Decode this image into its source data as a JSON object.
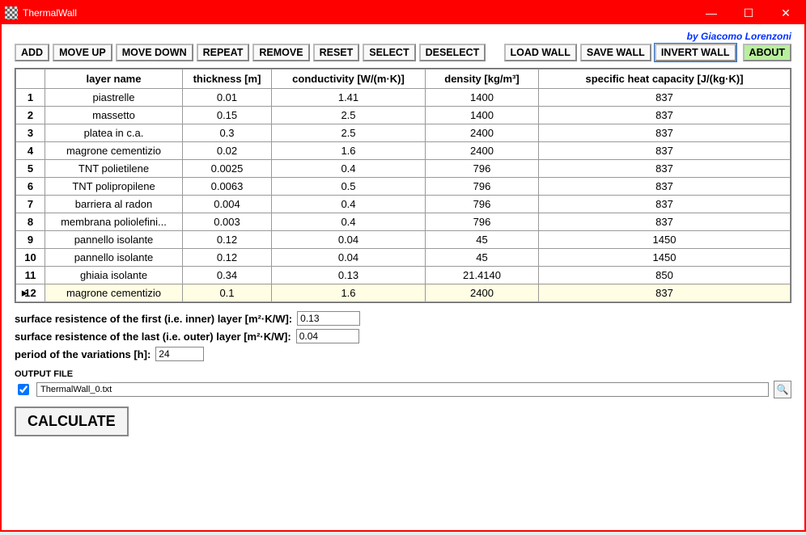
{
  "window": {
    "title": "ThermalWall"
  },
  "byline": "by Giacomo Lorenzoni",
  "win_controls": {
    "min": "—",
    "max": "☐",
    "close": "✕"
  },
  "toolbar": {
    "add": "ADD",
    "move_up": "MOVE UP",
    "move_down": "MOVE DOWN",
    "repeat": "REPEAT",
    "remove": "REMOVE",
    "reset": "RESET",
    "select": "SELECT",
    "deselect": "DESELECT",
    "load": "LOAD WALL",
    "save": "SAVE WALL",
    "invert": "INVERT WALL",
    "about": "ABOUT"
  },
  "columns": {
    "layer": "layer name",
    "thickness": "thickness  [m]",
    "conductivity": "conductivity  [W/(m·K)]",
    "density": "density  [kg/m³]",
    "shc": "specific heat capacity  [J/(kg·K)]"
  },
  "rows": [
    {
      "n": "1",
      "layer": "piastrelle",
      "thickness": "0.01",
      "conductivity": "1.41",
      "density": "1400",
      "shc": "837",
      "sel": false
    },
    {
      "n": "2",
      "layer": "massetto",
      "thickness": "0.15",
      "conductivity": "2.5",
      "density": "1400",
      "shc": "837",
      "sel": false
    },
    {
      "n": "3",
      "layer": "platea in c.a.",
      "thickness": "0.3",
      "conductivity": "2.5",
      "density": "2400",
      "shc": "837",
      "sel": false
    },
    {
      "n": "4",
      "layer": "magrone cementizio",
      "thickness": "0.02",
      "conductivity": "1.6",
      "density": "2400",
      "shc": "837",
      "sel": false
    },
    {
      "n": "5",
      "layer": "TNT polietilene",
      "thickness": "0.0025",
      "conductivity": "0.4",
      "density": "796",
      "shc": "837",
      "sel": false
    },
    {
      "n": "6",
      "layer": "TNT polipropilene",
      "thickness": "0.0063",
      "conductivity": "0.5",
      "density": "796",
      "shc": "837",
      "sel": false
    },
    {
      "n": "7",
      "layer": "barriera al radon",
      "thickness": "0.004",
      "conductivity": "0.4",
      "density": "796",
      "shc": "837",
      "sel": false
    },
    {
      "n": "8",
      "layer": "membrana poliolefini...",
      "thickness": "0.003",
      "conductivity": "0.4",
      "density": "796",
      "shc": "837",
      "sel": false
    },
    {
      "n": "9",
      "layer": "pannello isolante",
      "thickness": "0.12",
      "conductivity": "0.04",
      "density": "45",
      "shc": "1450",
      "sel": false
    },
    {
      "n": "10",
      "layer": "pannello isolante",
      "thickness": "0.12",
      "conductivity": "0.04",
      "density": "45",
      "shc": "1450",
      "sel": false
    },
    {
      "n": "11",
      "layer": "ghiaia isolante",
      "thickness": "0.34",
      "conductivity": "0.13",
      "density": "21.4140",
      "shc": "850",
      "sel": false
    },
    {
      "n": "12",
      "layer": "magrone cementizio",
      "thickness": "0.1",
      "conductivity": "1.6",
      "density": "2400",
      "shc": "837",
      "sel": true
    }
  ],
  "form": {
    "res_inner_label": "surface resistence of the first (i.e. inner) layer [m²·K/W]:",
    "res_inner_value": "0.13",
    "res_outer_label": "surface resistence of the last (i.e. outer) layer [m²·K/W]:",
    "res_outer_value": "0.04",
    "period_label": "period of the variations [h]:",
    "period_value": "24"
  },
  "output": {
    "label": "OUTPUT FILE",
    "checked": true,
    "path": "ThermalWall_0.txt"
  },
  "calculate": "CALCULATE"
}
